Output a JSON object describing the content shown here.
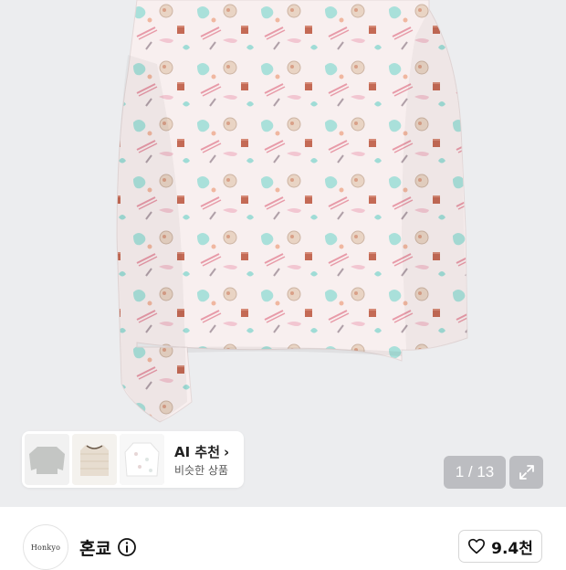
{
  "product": {
    "image_description_name": "patterned-long-sleeve-blouse",
    "colors": {
      "background": "#ecedef",
      "fabric": "#f7eeee",
      "mint": "#9fdcd6",
      "pink": "#f3c3cf",
      "brown": "#b06a52"
    }
  },
  "ai_recommend": {
    "title": "AI 추천",
    "chevron": "›",
    "subtitle": "비슷한 상품",
    "thumbnails": [
      "grey-knit-top",
      "beige-striped-top",
      "white-patterned-blouse"
    ]
  },
  "gallery": {
    "counter": "1 / 13",
    "fullscreen_icon": "expand-icon"
  },
  "brand": {
    "name": "혼쿄",
    "logo_text": "Honkyo",
    "info_icon": "info-icon"
  },
  "like": {
    "icon": "heart-icon",
    "count": "9.4천"
  }
}
